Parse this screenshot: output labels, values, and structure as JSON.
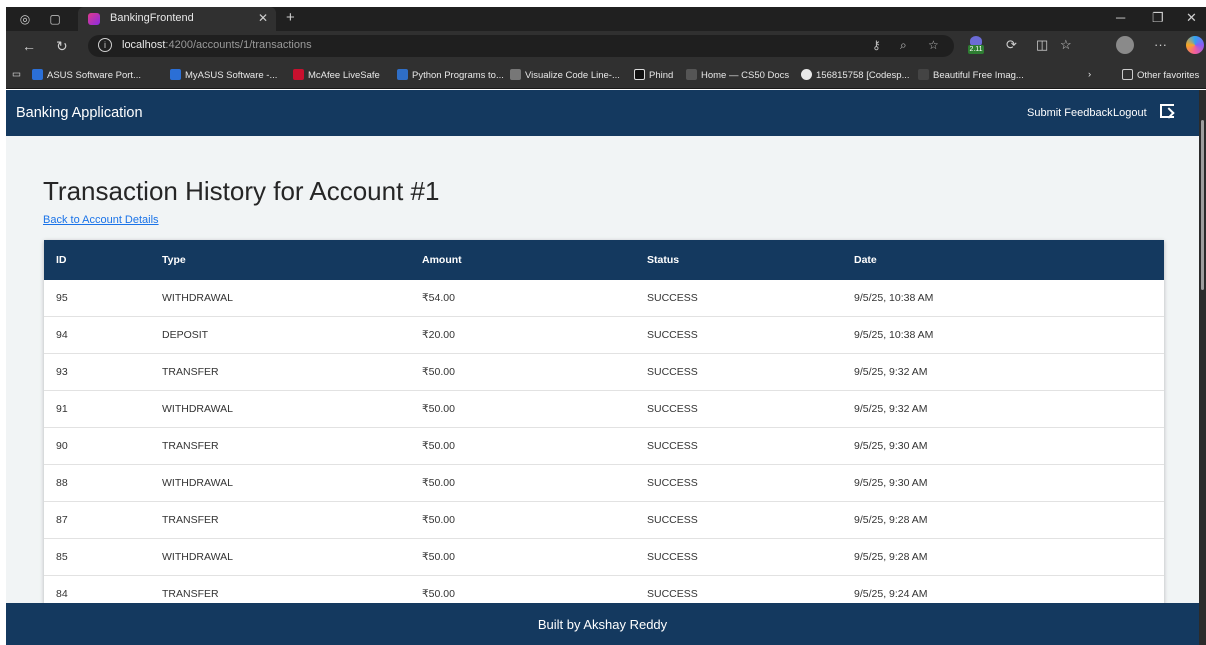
{
  "browser": {
    "tab_title": "BankingFrontend",
    "url_host": "localhost",
    "url_path": ":4200/accounts/1/transactions",
    "extension_badge": "2.11",
    "bookmarks": [
      "ASUS Software Port...",
      "MyASUS Software -...",
      "McAfee LiveSafe",
      "Python Programs to...",
      "Visualize Code Line-...",
      "Phind",
      "Home — CS50 Docs",
      "156815758 [Codesp...",
      "Beautiful Free Imag..."
    ],
    "other_favorites": "Other favorites"
  },
  "app": {
    "brand": "Banking Application",
    "nav": {
      "feedback": "Submit Feedback",
      "logout": "Logout"
    },
    "heading": "Transaction History for Account #1",
    "back_link": "Back to Account Details",
    "columns": [
      "ID",
      "Type",
      "Amount",
      "Status",
      "Date"
    ],
    "rows": [
      {
        "id": "95",
        "type": "WITHDRAWAL",
        "amount": "₹54.00",
        "status": "SUCCESS",
        "date": "9/5/25, 10:38 AM"
      },
      {
        "id": "94",
        "type": "DEPOSIT",
        "amount": "₹20.00",
        "status": "SUCCESS",
        "date": "9/5/25, 10:38 AM"
      },
      {
        "id": "93",
        "type": "TRANSFER",
        "amount": "₹50.00",
        "status": "SUCCESS",
        "date": "9/5/25, 9:32 AM"
      },
      {
        "id": "91",
        "type": "WITHDRAWAL",
        "amount": "₹50.00",
        "status": "SUCCESS",
        "date": "9/5/25, 9:32 AM"
      },
      {
        "id": "90",
        "type": "TRANSFER",
        "amount": "₹50.00",
        "status": "SUCCESS",
        "date": "9/5/25, 9:30 AM"
      },
      {
        "id": "88",
        "type": "WITHDRAWAL",
        "amount": "₹50.00",
        "status": "SUCCESS",
        "date": "9/5/25, 9:30 AM"
      },
      {
        "id": "87",
        "type": "TRANSFER",
        "amount": "₹50.00",
        "status": "SUCCESS",
        "date": "9/5/25, 9:28 AM"
      },
      {
        "id": "85",
        "type": "WITHDRAWAL",
        "amount": "₹50.00",
        "status": "SUCCESS",
        "date": "9/5/25, 9:28 AM"
      },
      {
        "id": "84",
        "type": "TRANSFER",
        "amount": "₹50.00",
        "status": "SUCCESS",
        "date": "9/5/25, 9:24 AM"
      }
    ],
    "footer": "Built by Akshay Reddy"
  },
  "colors": {
    "primary": "#14395f",
    "background": "#f1f4f5",
    "link": "#1a73e8"
  }
}
